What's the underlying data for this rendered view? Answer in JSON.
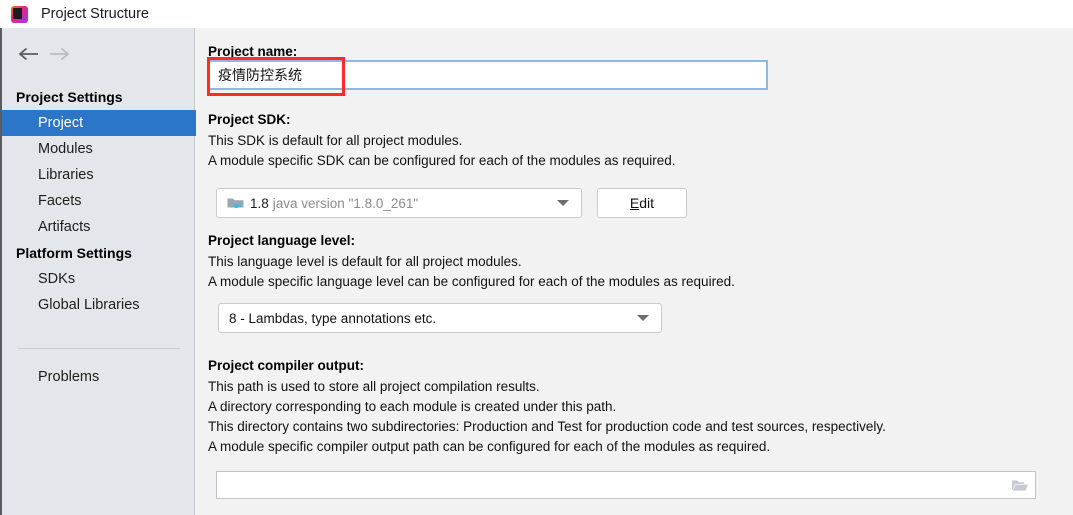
{
  "window": {
    "title": "Project Structure",
    "app_icon": "intellij-idea-icon",
    "icon_letter": "IJ"
  },
  "navigation": {
    "back_icon": "arrow-left-icon",
    "forward_icon": "arrow-right-icon",
    "back_enabled": "true",
    "forward_enabled": "false"
  },
  "sidebar": {
    "groups": [
      {
        "label": "Project Settings"
      },
      {
        "label": "Platform Settings"
      }
    ],
    "items": [
      {
        "label": "Project",
        "selected": true
      },
      {
        "label": "Modules",
        "selected": false
      },
      {
        "label": "Libraries",
        "selected": false
      },
      {
        "label": "Facets",
        "selected": false
      },
      {
        "label": "Artifacts",
        "selected": false
      },
      {
        "label": "SDKs",
        "selected": false
      },
      {
        "label": "Global Libraries",
        "selected": false
      },
      {
        "label": "Problems",
        "selected": false
      }
    ]
  },
  "content": {
    "project_name": {
      "label": "Project name:",
      "value": "疫情防控系统",
      "placeholder": ""
    },
    "project_sdk": {
      "label": "Project SDK:",
      "desc_line1": "This SDK is default for all project modules.",
      "desc_line2": "A module specific SDK can be configured for each of the modules as required.",
      "selected_version": "1.8",
      "selected_desc": "java version \"1.8.0_261\"",
      "icon": "folder-java-icon",
      "edit_button": {
        "mnemonic": "E",
        "rest": "dit"
      }
    },
    "language_level": {
      "label": "Project language level:",
      "desc_line1": "This language level is default for all project modules.",
      "desc_line2": "A module specific language level can be configured for each of the modules as required.",
      "selected": "8 - Lambdas, type annotations etc."
    },
    "compiler_output": {
      "label": "Project compiler output:",
      "desc_line1": "This path is used to store all project compilation results.",
      "desc_line2": "A directory corresponding to each module is created under this path.",
      "desc_line3": "This directory contains two subdirectories: Production and Test for production code and test sources, respectively.",
      "desc_line4": "A module specific compiler output path can be configured for each of the modules as required.",
      "value": "",
      "placeholder": "",
      "browse_icon": "folder-open-icon"
    }
  },
  "annotation": {
    "name": "red-highlight-box",
    "color": "#fd2d25"
  },
  "colors": {
    "selection_blue": "#2c76c7",
    "sidebar_bg": "#e3e7eb",
    "content_bg": "#f2f2f2",
    "field_focus_border": "#8fb8e8",
    "annotation_red": "#fd2d25"
  }
}
